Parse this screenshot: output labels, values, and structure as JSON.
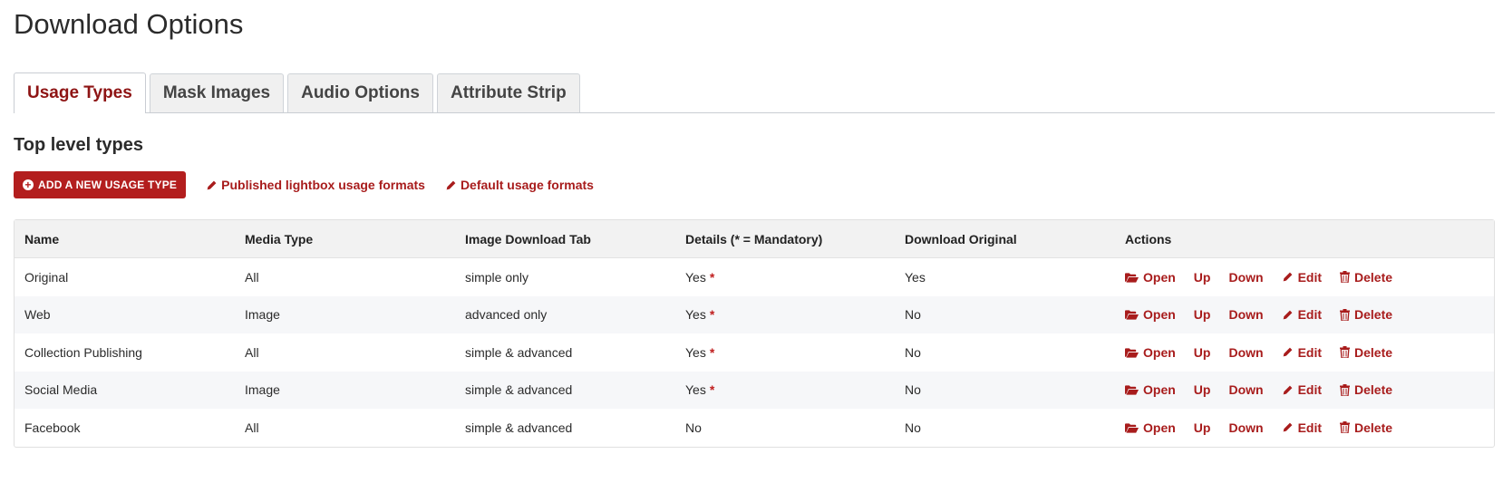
{
  "page": {
    "title": "Download Options"
  },
  "tabs": [
    {
      "label": "Usage Types",
      "active": true
    },
    {
      "label": "Mask Images",
      "active": false
    },
    {
      "label": "Audio Options",
      "active": false
    },
    {
      "label": "Attribute Strip",
      "active": false
    }
  ],
  "section": {
    "title": "Top level types"
  },
  "toolbar": {
    "add_label": "ADD A NEW USAGE TYPE",
    "link1": "Published lightbox usage formats",
    "link2": "Default usage formats"
  },
  "table": {
    "headers": [
      "Name",
      "Media Type",
      "Image Download Tab",
      "Details (* = Mandatory)",
      "Download Original",
      "Actions"
    ],
    "rows": [
      {
        "name": "Original",
        "media": "All",
        "tab": "simple only",
        "details": "Yes",
        "mandatory": "*",
        "original": "Yes"
      },
      {
        "name": "Web",
        "media": "Image",
        "tab": "advanced only",
        "details": "Yes",
        "mandatory": "*",
        "original": "No"
      },
      {
        "name": "Collection Publishing",
        "media": "All",
        "tab": "simple & advanced",
        "details": "Yes",
        "mandatory": "*",
        "original": "No"
      },
      {
        "name": "Social Media",
        "media": "Image",
        "tab": "simple & advanced",
        "details": "Yes",
        "mandatory": "*",
        "original": "No"
      },
      {
        "name": "Facebook",
        "media": "All",
        "tab": "simple & advanced",
        "details": "No",
        "mandatory": "",
        "original": "No"
      }
    ],
    "actions": {
      "open": "Open",
      "up": "Up",
      "down": "Down",
      "edit": "Edit",
      "delete": "Delete"
    }
  },
  "colors": {
    "accent": "#b31e1e",
    "link": "#a81c1c",
    "active_tab": "#8e1414"
  },
  "icons": {
    "add": "plus-circle-icon",
    "edit": "pencil-icon",
    "open": "folder-open-icon",
    "delete": "trash-icon"
  }
}
